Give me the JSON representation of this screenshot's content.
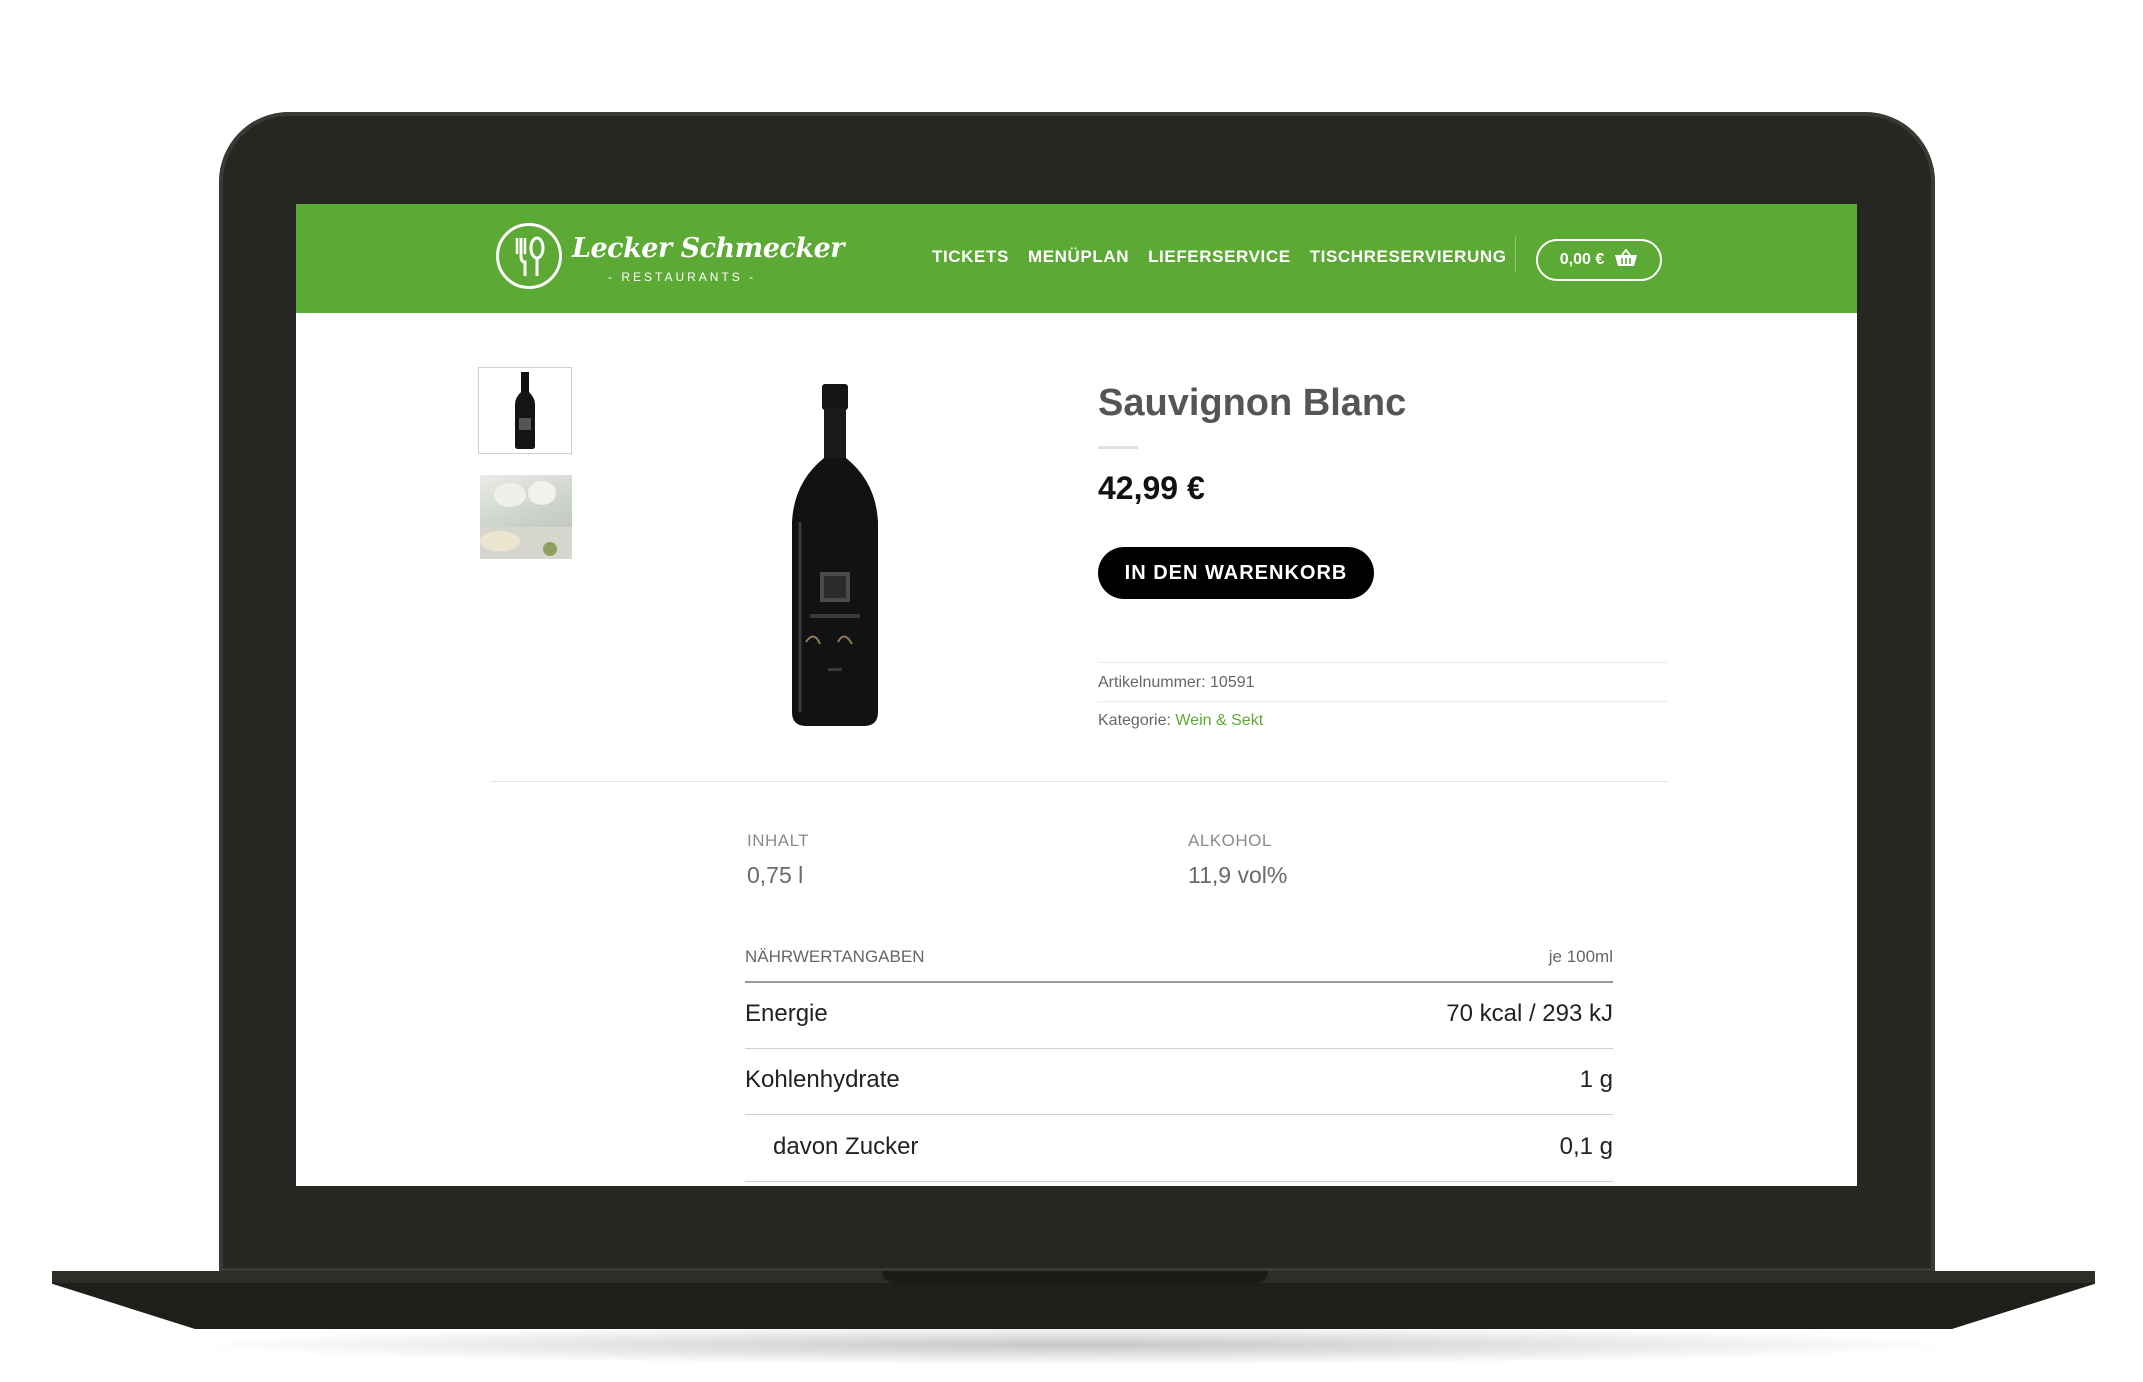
{
  "header": {
    "logo_title": "Lecker Schmecker",
    "logo_subtitle": "- RESTAURANTS -",
    "nav": [
      "TICKETS",
      "MENÜPLAN",
      "LIEFERSERVICE",
      "TISCHRESERVIERUNG"
    ],
    "cart_total": "0,00 €",
    "cart_icon": "basket-icon",
    "brand_color": "#5da935"
  },
  "product": {
    "title": "Sauvignon Blanc",
    "price": "42,99 €",
    "buy_label": "IN DEN WARENKORB",
    "sku_label": "Artikelnummer:",
    "sku": "10591",
    "category_label": "Kategorie:",
    "category": "Wein & Sekt"
  },
  "attributes": {
    "content_label": "INHALT",
    "content_value": "0,75 l",
    "alcohol_label": "ALKOHOL",
    "alcohol_value": "11,9 vol%"
  },
  "nutrition": {
    "title": "NÄHRWERTANGABEN",
    "per": "je 100ml",
    "rows": [
      {
        "label": "Energie",
        "value": "70 kcal / 293 kJ"
      },
      {
        "label": "Kohlenhydrate",
        "value": "1 g"
      },
      {
        "label": "davon Zucker",
        "value": "0,1 g"
      }
    ]
  }
}
